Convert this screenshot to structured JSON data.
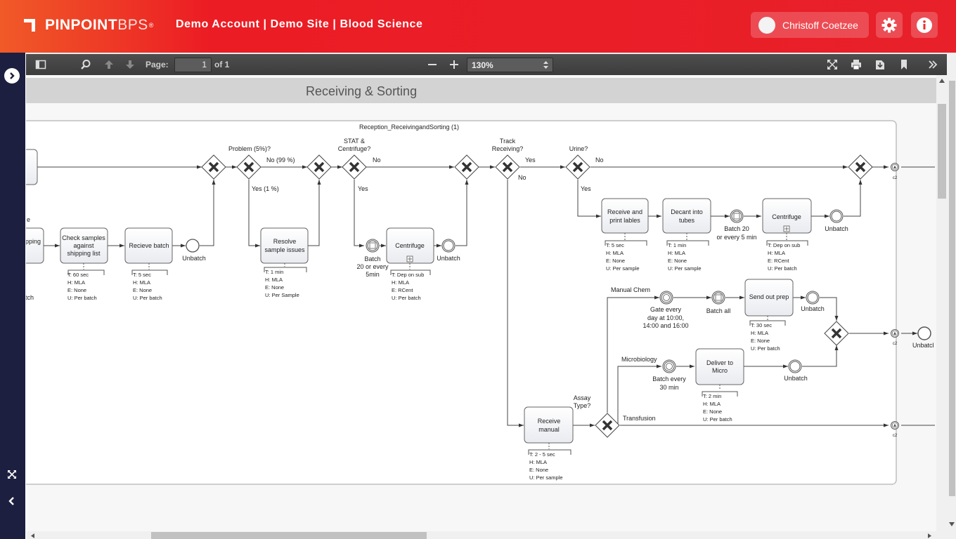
{
  "header": {
    "logo_bold": "PINPOINT",
    "logo_light": "BPS",
    "logo_reg": "®",
    "account_line": "Demo Account | Demo Site | Blood Science",
    "user_name": "Christoff Coetzee",
    "settings_icon": "gear-icon",
    "info_icon": "info-icon"
  },
  "toolbar": {
    "page_label": "Page:",
    "page_value": "1",
    "page_of": "of 1",
    "zoom_value": "130%"
  },
  "document": {
    "heading": "Receiving & Sorting",
    "pool_title": "Reception_ReceivingandSorting (1)"
  },
  "diagram": {
    "gateway_labels": {
      "problem": "Problem (5%)?",
      "stat": "STAT &",
      "centrifuge_q": "Centrifuge?",
      "track": "Track",
      "receiving_q": "Receiving?",
      "urine": "Urine?",
      "assay": "Assay",
      "type_q": "Type?"
    },
    "flow_labels": {
      "no_99": "No (99 %)",
      "yes_1": "Yes (1 %)",
      "no": "No",
      "yes": "Yes",
      "manual_chem": "Manual Chem",
      "microbiology": "Microbiology",
      "transfusion": "Transfusion"
    },
    "tasks": {
      "check": [
        "Check samples",
        "against",
        "shipping list"
      ],
      "recieve_batch": "Recieve batch",
      "resolve": [
        "Resolve",
        "sample issues"
      ],
      "centrifuge": "Centrifuge",
      "receive_print": [
        "Receive and",
        "print lables"
      ],
      "decant": [
        "Decant into",
        "tubes"
      ],
      "send_out": "Send out prep",
      "deliver": [
        "Deliver to",
        "Micro"
      ],
      "receive_manual": [
        "Receive",
        "manual"
      ],
      "partial_left": "pping"
    },
    "events": {
      "unbatch": "Unbatch",
      "batch_20_a": [
        "Batch",
        "20 or every",
        "5min"
      ],
      "batch_20_b": [
        "Batch 20",
        "or every 5 min"
      ],
      "gate": [
        "Gate every",
        "day at 10:00,",
        "14:00 and 16:00"
      ],
      "batch_all": "Batch all",
      "batch_30": [
        "Batch every",
        "30 min"
      ],
      "unbatch_cut": "Unbatcl",
      "c2": "c2",
      "left_e": "e",
      "left_tch": "tch"
    },
    "annotations": {
      "check": [
        "T:  60 sec",
        "H:  MLA",
        "E:  None",
        "U:  Per batch"
      ],
      "recieve_batch": [
        "T:  5 sec",
        "H:  MLA",
        "E:  None",
        "U:  Per batch"
      ],
      "resolve": [
        "T:  1 min",
        "H:  MLA",
        "E:  None",
        "U:  Per Sample"
      ],
      "centrifuge": [
        "T:  Dep on sub",
        "H:  MLA",
        "E:  RCent",
        "U:  Per batch"
      ],
      "receive_print": [
        "T:  5 sec",
        "H:  MLA",
        "E:  None",
        "U:  Per sample"
      ],
      "decant": [
        "T:  1 min",
        "H:  MLA",
        "E:  None",
        "U:  Per sample"
      ],
      "centrifuge2": [
        "T:  Dep on sub",
        "H:  MLA",
        "E:  RCent",
        "U:  Per batch"
      ],
      "send_out": [
        "T:  30 sec",
        "H:  MLA",
        "E:  None",
        "U:  Per batch"
      ],
      "deliver": [
        "T:  2 min",
        "H:  MLA",
        "E:  None",
        "U:  Per batch"
      ],
      "receive_manual": [
        "T:  2 - 5 sec",
        "H:  MLA",
        "E:  None",
        "U:  Per sample"
      ]
    }
  }
}
